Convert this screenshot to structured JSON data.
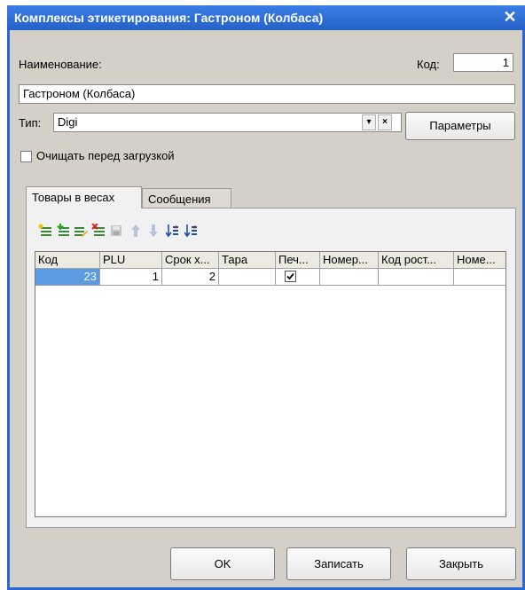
{
  "window": {
    "title": "Комплексы этикетирования: Гастроном (Колбаса)",
    "close_glyph": "✕",
    "titlebar_color": "#2a68cf"
  },
  "form": {
    "name_label": "Наименование:",
    "name_value": "Гастроном (Колбаса)",
    "code_label": "Код:",
    "code_value": "1",
    "type_label": "Тип:",
    "type_value": "Digi",
    "type_dropdown_glyph": "▾",
    "type_clear_glyph": "×",
    "params_button": "Параметры",
    "clear_before_load_label": "Очищать перед загрузкой",
    "clear_before_load_checked": false
  },
  "tabs": [
    {
      "label": "Товары в весах",
      "active": true
    },
    {
      "label": "Сообщения",
      "active": false
    }
  ],
  "toolbar": {
    "icons": [
      "add-row-icon",
      "add-child-row-icon",
      "edit-row-icon",
      "delete-row-icon",
      "save-disabled-icon",
      "move-up-icon",
      "move-down-icon",
      "sort-ascending-icon",
      "sort-descending-icon"
    ]
  },
  "table": {
    "columns": [
      "Код",
      "PLU",
      "Срок х...",
      "Тара",
      "Печ...",
      "Номер...",
      "Код рост...",
      "Номе..."
    ],
    "rows": [
      {
        "code": "23",
        "plu": "1",
        "shelf_life": "2",
        "tare": "",
        "print_checked": true,
        "number": "",
        "growth_code": "",
        "number2": ""
      }
    ]
  },
  "buttons": {
    "ok": "OK",
    "save": "Записать",
    "close": "Закрыть"
  }
}
